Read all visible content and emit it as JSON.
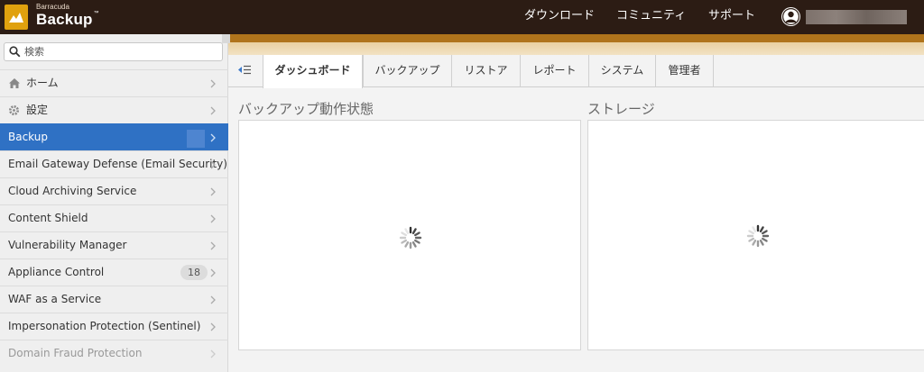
{
  "brand": {
    "small": "Barracuda",
    "name": "Backup",
    "tm": "™"
  },
  "topnav": {
    "download": "ダウンロード",
    "community": "コミュニティ",
    "support": "サポート"
  },
  "search": {
    "placeholder": "検索"
  },
  "sidebar": {
    "items": [
      {
        "label": "ホーム",
        "icon": "home-icon"
      },
      {
        "label": "設定",
        "icon": "gear-icon"
      },
      {
        "label": "Backup",
        "active": true
      },
      {
        "label": "Email Gateway Defense (Email Security)"
      },
      {
        "label": "Cloud Archiving Service"
      },
      {
        "label": "Content Shield"
      },
      {
        "label": "Vulnerability Manager"
      },
      {
        "label": "Appliance Control",
        "badge": "18"
      },
      {
        "label": "WAF as a Service"
      },
      {
        "label": "Impersonation Protection (Sentinel)"
      },
      {
        "label": "Domain Fraud Protection",
        "disabled": true
      }
    ]
  },
  "tabs": [
    {
      "label": "ダッシュボード",
      "active": true
    },
    {
      "label": "バックアップ"
    },
    {
      "label": "リストア"
    },
    {
      "label": "レポート"
    },
    {
      "label": "システム"
    },
    {
      "label": "管理者"
    }
  ],
  "panels": {
    "backup_status": "バックアップ動作状態",
    "storage": "ストレージ"
  },
  "colors": {
    "topbar": "#2c1c14",
    "accent": "#e0a10e",
    "active_nav": "#2f71c4"
  }
}
